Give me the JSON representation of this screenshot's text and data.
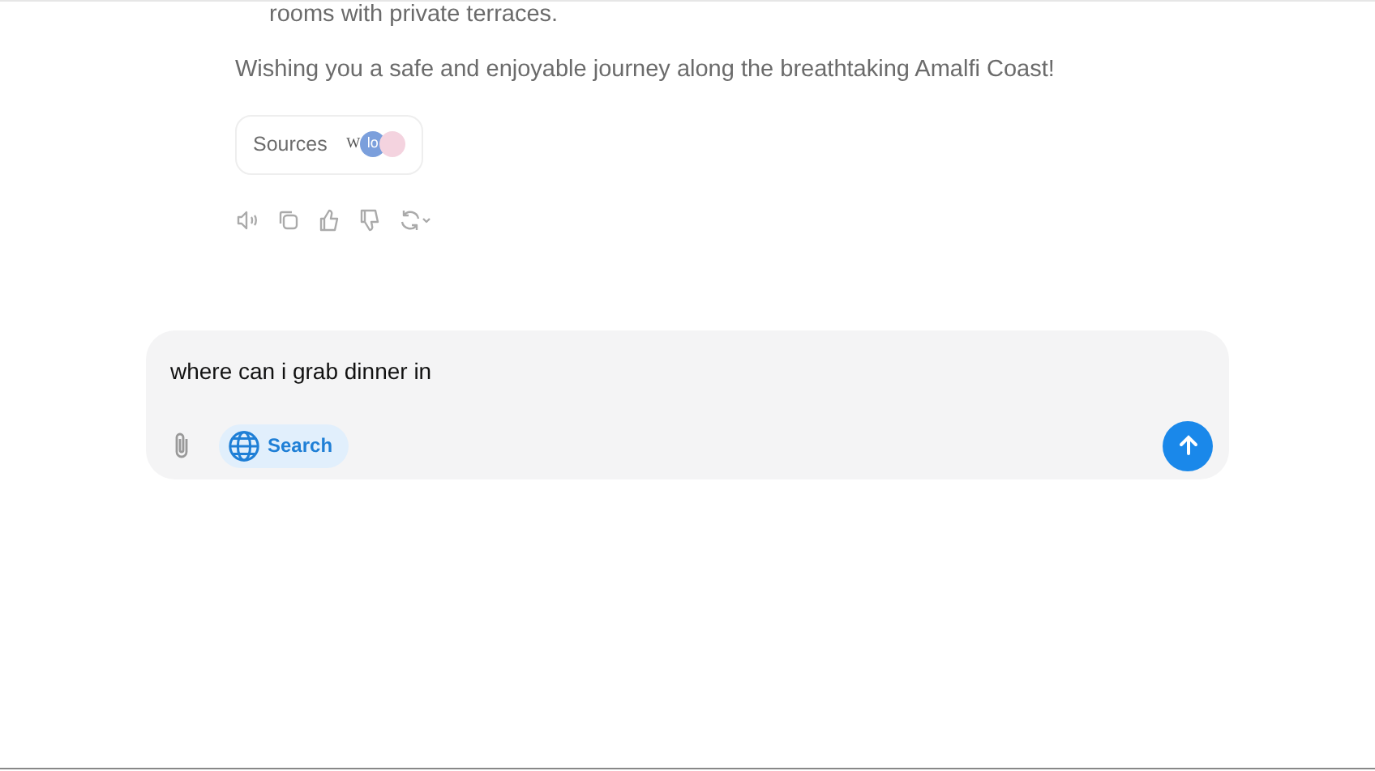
{
  "message": {
    "list_tail": "rooms with private terraces.",
    "closing": "Wishing you a safe and enjoyable journey along the breathtaking Amalfi Coast!",
    "sources": {
      "label": "Sources",
      "favicons": [
        {
          "text": "W",
          "color": "#ffffff"
        },
        {
          "text": "lo",
          "color": "#7b9fdc"
        },
        {
          "color": "#f4d3df"
        }
      ]
    },
    "actions": [
      {
        "kind": "speaker"
      },
      {
        "kind": "copy"
      },
      {
        "kind": "like"
      },
      {
        "kind": "dislike"
      },
      {
        "kind": "regenerate"
      }
    ]
  },
  "composer": {
    "value": "where can i grab dinner in",
    "search": {
      "label": "Search",
      "selected": true
    }
  }
}
